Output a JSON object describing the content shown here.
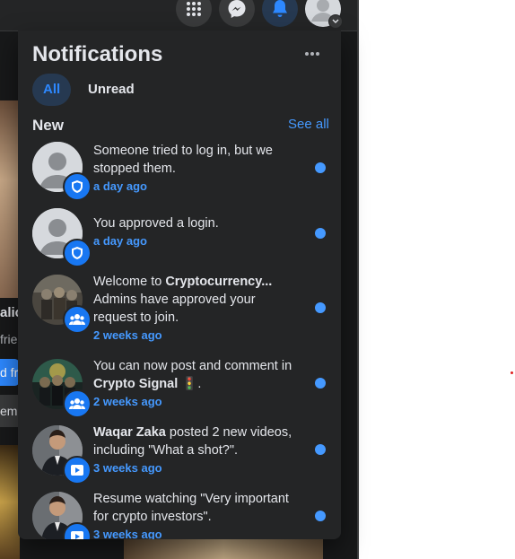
{
  "panel": {
    "title": "Notifications",
    "more_icon": "more-horizontal-icon",
    "tabs": [
      {
        "label": "All",
        "active": true
      },
      {
        "label": "Unread",
        "active": false
      }
    ],
    "section_title": "New",
    "see_all": "See all"
  },
  "notifications": [
    {
      "pre": "Someone tried to log in, but we stopped them.",
      "bold": "",
      "post": "",
      "time": "a day ago",
      "badge_icon": "shield-icon",
      "avatar": "default-avatar",
      "unread": true
    },
    {
      "pre": "You approved a login.",
      "bold": "",
      "post": "",
      "time": "a day ago",
      "badge_icon": "shield-icon",
      "avatar": "default-avatar",
      "unread": true
    },
    {
      "pre": "Welcome to ",
      "bold": "Cryptocurrency...",
      "post": " Admins have approved your request to join.",
      "time": "2 weeks ago",
      "badge_icon": "group-icon",
      "avatar": "group-photo",
      "unread": true
    },
    {
      "pre": "You can now post and comment in ",
      "bold": "Crypto Signal",
      "post": " 🚦.",
      "time": "2 weeks ago",
      "badge_icon": "group-icon",
      "avatar": "group-photo",
      "unread": true
    },
    {
      "pre": "",
      "bold": "Waqar Zaka",
      "post": " posted 2 new videos, including \"What a shot?\".",
      "time": "3 weeks ago",
      "badge_icon": "video-icon",
      "avatar": "profile-photo",
      "unread": true
    },
    {
      "pre": "Resume watching \"Very important for crypto investors\".",
      "bold": "",
      "post": "",
      "time": "3 weeks ago",
      "badge_icon": "video-icon",
      "avatar": "profile-photo",
      "unread": true
    }
  ],
  "background": {
    "name_fragment": "alic",
    "friends_fragment": "frie",
    "button_fragment": "d fr",
    "button2_fragment": "em"
  },
  "colors": {
    "panel": "#242526",
    "accent": "#2d88ff",
    "link": "#4599ff",
    "text": "#e4e6eb"
  }
}
